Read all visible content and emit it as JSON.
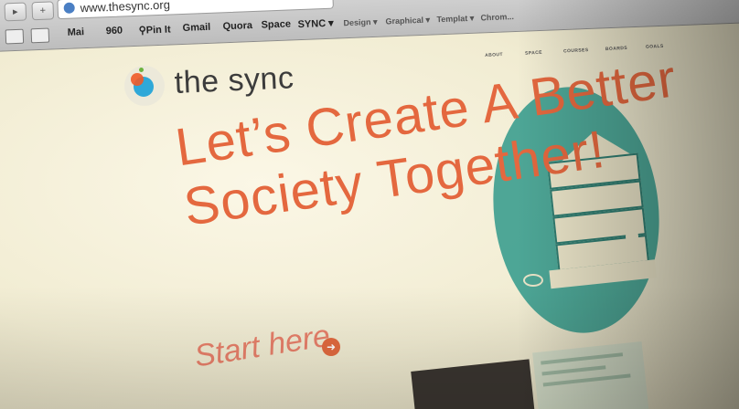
{
  "browser": {
    "url": "www.thesync.org",
    "bookmarks": [
      "Mai",
      "960",
      "Pin It",
      "Gmail",
      "Quora",
      "Space",
      "SYNC",
      "Design",
      "Graphical",
      "Templat",
      "Chrom..."
    ]
  },
  "site": {
    "brand": "the sync",
    "nav": [
      "ABOUT",
      "SPACE",
      "COURSES",
      "BOARDS",
      "GOALS"
    ],
    "headline_lines": [
      "Let’s Create A Better",
      "Society Together!"
    ],
    "cta": "Start here"
  },
  "colors": {
    "headline": "#e4683f",
    "circle": "#3f9f90",
    "logo_blue": "#2fa8d8",
    "logo_orange": "#f05a28"
  }
}
